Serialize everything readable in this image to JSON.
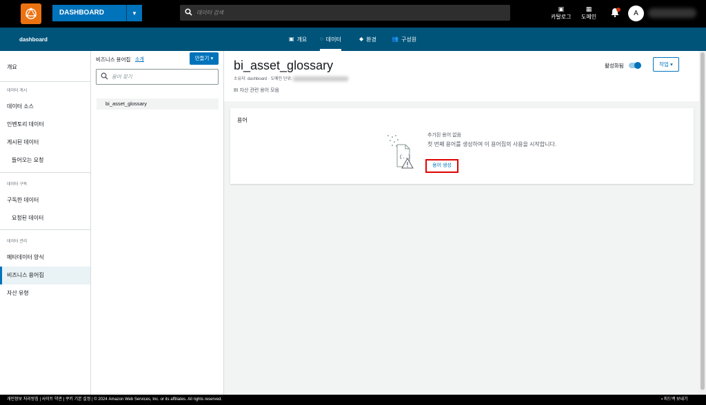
{
  "topbar": {
    "project_name": "DASHBOARD",
    "search_placeholder": "데이터 검색",
    "catalog_label": "카탈로그",
    "domain_label": "도메인",
    "avatar_initial": "A"
  },
  "subbar": {
    "breadcrumb": "dashboard",
    "tabs": [
      {
        "label": "개요",
        "icon": "image-icon"
      },
      {
        "label": "데이터",
        "icon": "refresh-icon"
      },
      {
        "label": "환경",
        "icon": "layers-icon"
      },
      {
        "label": "구성원",
        "icon": "users-icon"
      }
    ]
  },
  "sidebar": {
    "overview": "개요",
    "section_publish": "데이터 게시",
    "data_source": "데이터 소스",
    "inventory": "인벤토리 데이터",
    "published": "게시된 데이터",
    "incoming": "들어오는 요청",
    "section_subscribe": "데이터 구독",
    "subscribed": "구독한 데이터",
    "requested": "요청된 데이터",
    "section_manage": "데이터 관리",
    "metadata_forms": "메타데이터 양식",
    "glossaries": "비즈니스 용어집",
    "asset_types": "자산 유형"
  },
  "glossary_panel": {
    "title": "비즈니스 용어집",
    "intro_link": "소개",
    "create_button": "만들기",
    "search_placeholder": "용어 찾기",
    "items": [
      "bi_asset_glossary"
    ]
  },
  "main": {
    "title": "bi_asset_glossary",
    "owner_label": "소유자:",
    "owner_value": "dashboard",
    "domain_unit_label": "도메인 단위:",
    "description": "BI 자산 관련 용어 모음",
    "toggle_label": "활성화됨",
    "actions_button": "작업",
    "terms_card": {
      "title": "용어",
      "empty_title": "추가된 용어 없음",
      "empty_desc": "첫 번째 용어를 생성하여 이 용어집의 사용을 시작합니다.",
      "create_term": "용어 생성"
    }
  },
  "footer": {
    "left": "개인정보 처리방침 | 사이트 약관 | 쿠키 기본 설정 | © 2024 Amazon Web Services, Inc. or its affiliates. All rights reserved.",
    "feedback": "피드백 보내기"
  }
}
